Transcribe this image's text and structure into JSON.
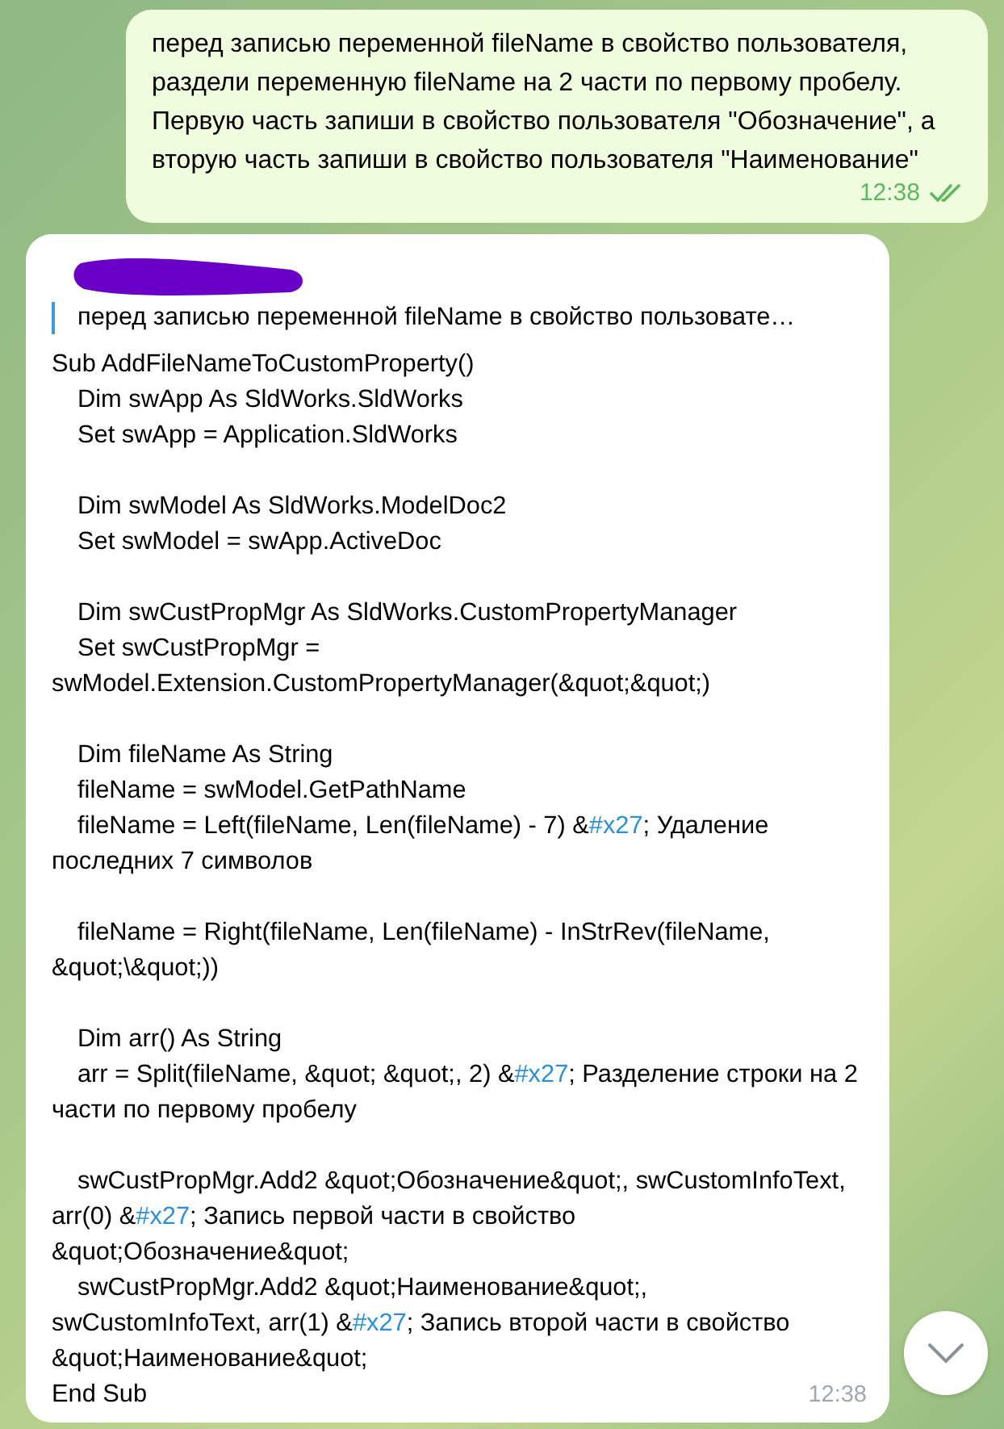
{
  "outgoing": {
    "text": "перед записью переменной fileName в свойство пользователя, раздели переменную fileName на 2 части по первому пробелу. Первую часть запиши в свойство пользователя \"Обозначение\", а вторую часть запиши в свойство пользователя \"Наименование\"",
    "time": "12:38",
    "read": true
  },
  "incoming": {
    "reply": {
      "sender_hidden": true,
      "quote": "перед записью переменной fileName в свойство пользовате…"
    },
    "lines": [
      {
        "kind": "code",
        "indent": false,
        "parts": [
          {
            "kind": "text",
            "text": "Sub AddFileNameToCustomProperty()"
          }
        ]
      },
      {
        "kind": "code",
        "indent": true,
        "parts": [
          {
            "kind": "text",
            "text": "Dim swApp As SldWorks.SldWorks"
          }
        ]
      },
      {
        "kind": "code",
        "indent": true,
        "parts": [
          {
            "kind": "text",
            "text": "Set swApp = Application.SldWorks"
          }
        ]
      },
      {
        "kind": "blank"
      },
      {
        "kind": "code",
        "indent": true,
        "parts": [
          {
            "kind": "text",
            "text": "Dim swModel As SldWorks.ModelDoc2"
          }
        ]
      },
      {
        "kind": "code",
        "indent": true,
        "parts": [
          {
            "kind": "text",
            "text": "Set swModel = swApp.ActiveDoc"
          }
        ]
      },
      {
        "kind": "blank"
      },
      {
        "kind": "code",
        "indent": true,
        "parts": [
          {
            "kind": "text",
            "text": "Dim swCustPropMgr As SldWorks.CustomPropertyManager"
          }
        ]
      },
      {
        "kind": "code",
        "indent": true,
        "parts": [
          {
            "kind": "text",
            "text": "Set swCustPropMgr = swModel.Extension.CustomPropertyManager(&quot;&quot;)"
          }
        ]
      },
      {
        "kind": "blank"
      },
      {
        "kind": "code",
        "indent": true,
        "parts": [
          {
            "kind": "text",
            "text": "Dim fileName As String"
          }
        ]
      },
      {
        "kind": "code",
        "indent": true,
        "parts": [
          {
            "kind": "text",
            "text": "fileName = swModel.GetPathName"
          }
        ]
      },
      {
        "kind": "code",
        "indent": true,
        "parts": [
          {
            "kind": "text",
            "text": "fileName = Left(fileName, Len(fileName) - 7) &"
          },
          {
            "kind": "hashtag",
            "text": "#x27"
          },
          {
            "kind": "text",
            "text": "; Удаление последних 7 символов"
          }
        ]
      },
      {
        "kind": "blank"
      },
      {
        "kind": "code",
        "indent": true,
        "parts": [
          {
            "kind": "text",
            "text": "fileName = Right(fileName, Len(fileName) - InStrRev(fileName, &quot;\\&quot;))"
          }
        ]
      },
      {
        "kind": "blank"
      },
      {
        "kind": "code",
        "indent": true,
        "parts": [
          {
            "kind": "text",
            "text": "Dim arr() As String"
          }
        ]
      },
      {
        "kind": "code",
        "indent": true,
        "parts": [
          {
            "kind": "text",
            "text": "arr = Split(fileName, &quot; &quot;, 2) &"
          },
          {
            "kind": "hashtag",
            "text": "#x27"
          },
          {
            "kind": "text",
            "text": "; Разделение строки на 2 части по первому пробелу"
          }
        ]
      },
      {
        "kind": "blank"
      },
      {
        "kind": "code",
        "indent": true,
        "parts": [
          {
            "kind": "text",
            "text": "swCustPropMgr.Add2 &quot;Обозначение&quot;, swCustomInfoText, arr(0) &"
          },
          {
            "kind": "hashtag",
            "text": "#x27"
          },
          {
            "kind": "text",
            "text": "; Запись первой части в свойство &quot;Обозначение&quot;"
          }
        ]
      },
      {
        "kind": "code",
        "indent": true,
        "parts": [
          {
            "kind": "text",
            "text": "swCustPropMgr.Add2 &quot;Наименование&quot;, swCustomInfoText, arr(1) &"
          },
          {
            "kind": "hashtag",
            "text": "#x27"
          },
          {
            "kind": "text",
            "text": "; Запись второй части в свойство &quot;Наименование&quot;"
          }
        ]
      },
      {
        "kind": "code",
        "indent": false,
        "parts": [
          {
            "kind": "text",
            "text": "End Sub"
          }
        ]
      }
    ],
    "time": "12:38"
  }
}
